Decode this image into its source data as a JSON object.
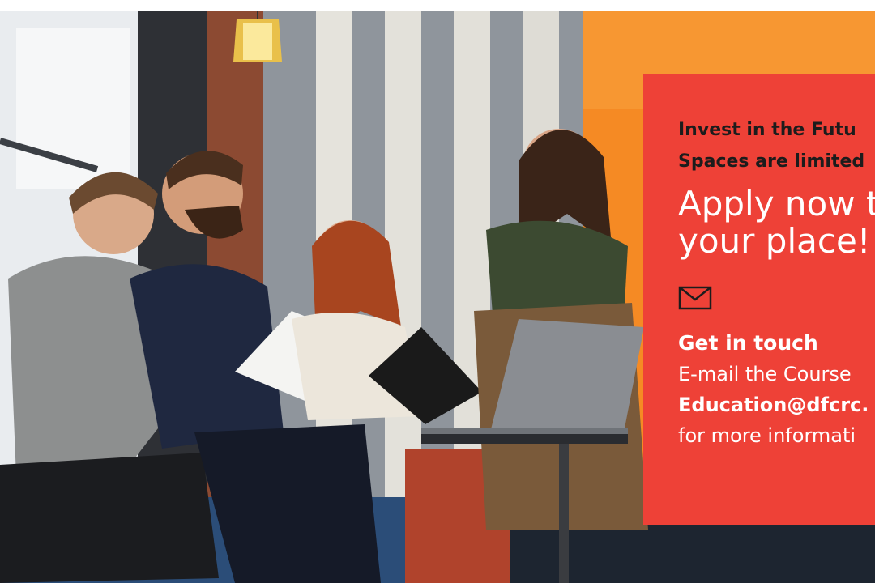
{
  "banner": {
    "lead_line_1": "Invest in the Futu",
    "lead_line_2": "Spaces are limited",
    "headline_line_1": "Apply now t",
    "headline_line_2": "your place!",
    "mail_icon": "envelope-icon",
    "contact_title": "Get in touch",
    "contact_line_1": "E-mail the Course",
    "contact_email": "Education@dfcrc.",
    "contact_line_2": "for more informati"
  },
  "colors": {
    "panel_red": "#ee4137",
    "orange_wall": "#f58a24",
    "dark_text": "#1c1c1c"
  }
}
